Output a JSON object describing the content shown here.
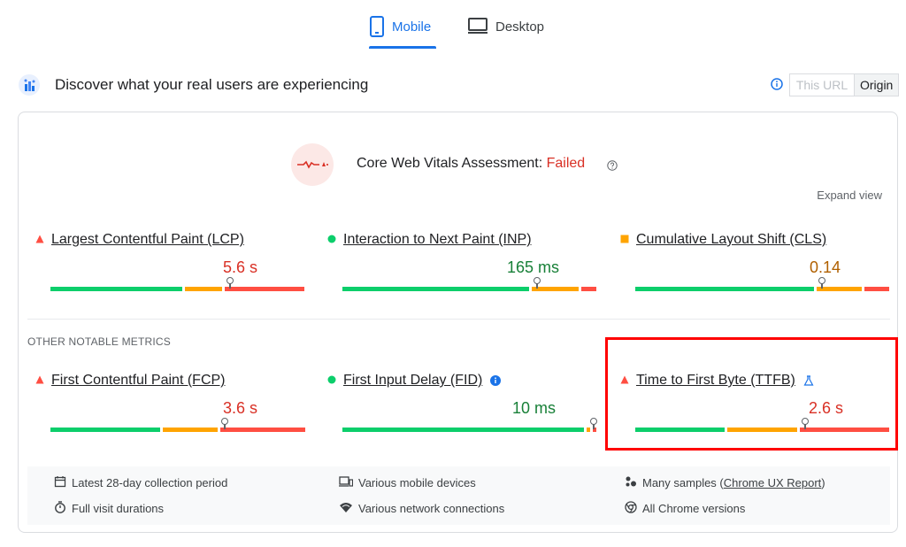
{
  "tabs": [
    {
      "label": "Mobile",
      "active": true,
      "icon": "smartphone-icon"
    },
    {
      "label": "Desktop",
      "active": false,
      "icon": "monitor-icon"
    }
  ],
  "header": {
    "title": "Discover what your real users are experiencing",
    "toggle": {
      "this_url": "This URL",
      "origin": "Origin",
      "selected": "Origin"
    }
  },
  "assessment": {
    "label": "Core Web Vitals Assessment:",
    "status": "Failed",
    "expand": "Expand view"
  },
  "core_metrics": [
    {
      "name": "Largest Contentful Paint (LCP)",
      "value": "5.6 s",
      "status": "poor",
      "dist": [
        0.53,
        0.15,
        0.32
      ]
    },
    {
      "name": "Interaction to Next Paint (INP)",
      "value": "165 ms",
      "status": "good",
      "dist": [
        0.75,
        0.19,
        0.06
      ]
    },
    {
      "name": "Cumulative Layout Shift (CLS)",
      "value": "0.14",
      "status": "needs-improvement",
      "dist": [
        0.72,
        0.18,
        0.1
      ]
    }
  ],
  "other_label": "OTHER NOTABLE METRICS",
  "other_metrics": [
    {
      "name": "First Contentful Paint (FCP)",
      "value": "3.6 s",
      "status": "poor",
      "dist": [
        0.44,
        0.22,
        0.34
      ]
    },
    {
      "name": "First Input Delay (FID)",
      "value": "10 ms",
      "status": "good",
      "dist": [
        0.97,
        0.015,
        0.015
      ]
    },
    {
      "name": "Time to First Byte (TTFB)",
      "value": "2.6 s",
      "status": "poor",
      "dist": [
        0.36,
        0.28,
        0.36
      ]
    }
  ],
  "footer": {
    "items": [
      {
        "icon": "calendar-icon",
        "text": "Latest 28-day collection period"
      },
      {
        "icon": "devices-icon",
        "text": "Various mobile devices"
      },
      {
        "icon": "samples-icon",
        "text": "Many samples (",
        "link": "Chrome UX Report",
        "suffix": ")"
      },
      {
        "icon": "timer-icon",
        "text": "Full visit durations"
      },
      {
        "icon": "wifi-icon",
        "text": "Various network connections"
      },
      {
        "icon": "chrome-icon",
        "text": "All Chrome versions"
      }
    ]
  },
  "colors": {
    "good": "#0cce6b",
    "needs": "#ffa400",
    "poor": "#ff4e42",
    "good_text": "#188038",
    "needs_text": "#b06000",
    "poor_text": "#d93025",
    "accent": "#1a73e8",
    "highlight": "#ff0000"
  }
}
